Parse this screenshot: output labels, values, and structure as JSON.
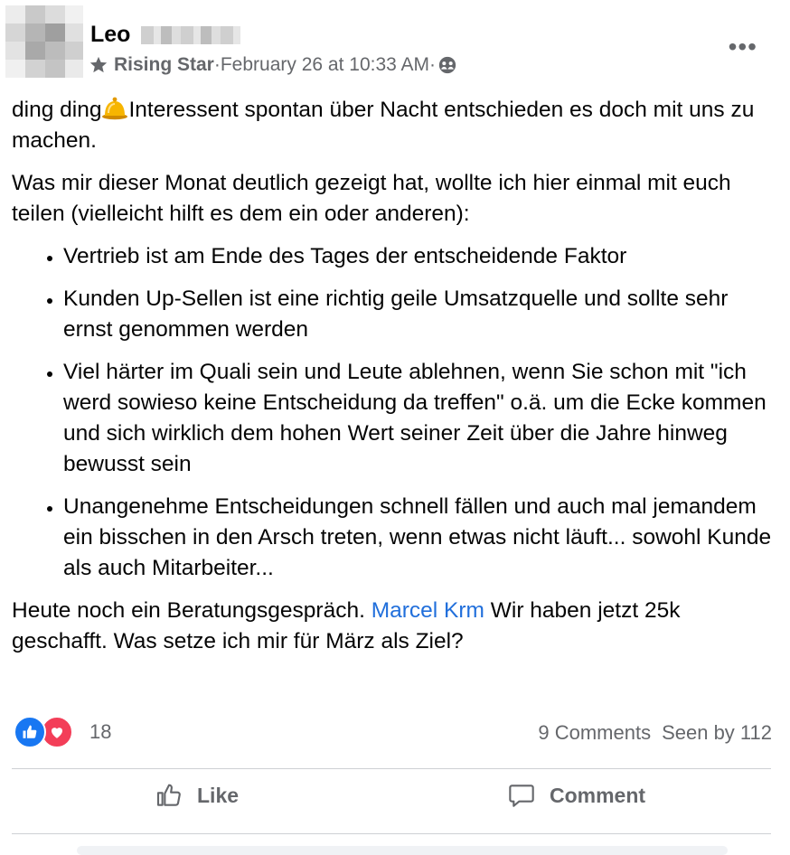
{
  "post": {
    "author_name": "Leo",
    "badge": "Rising Star",
    "separator": " · ",
    "timestamp": "February 26 at 10:33 AM",
    "separator2": " · ",
    "intro_start": "ding ding",
    "intro_rest": "Interessent spontan über Nacht entschieden es doch mit uns zu machen.",
    "paragraph2": "Was mir dieser Monat deutlich gezeigt hat, wollte ich hier einmal mit euch teilen (vielleicht hilft es dem ein oder anderen):",
    "bullets": [
      "Vertrieb ist am Ende des Tages der entscheidende Faktor",
      "Kunden Up-Sellen ist eine richtig geile Umsatzquelle und sollte sehr ernst genommen werden",
      "Viel härter im Quali sein und Leute ablehnen, wenn Sie schon mit \"ich werd sowieso keine Entscheidung da treffen\" o.ä. um die Ecke kommen und sich wirklich dem hohen Wert seiner Zeit über die Jahre hinweg bewusst sein",
      "Unangenehme Entscheidungen schnell fällen und auch mal jemandem ein bisschen in den Arsch treten, wenn etwas nicht läuft... sowohl Kunde als auch Mitarbeiter..."
    ],
    "closing_start": "Heute noch ein Beratungsgespräch. ",
    "mention": "Marcel Krm",
    "closing_end": " Wir haben jetzt 25k geschafft. Was setze ich mir für März als Ziel?",
    "more_label": "•••"
  },
  "reactions": {
    "count": "18",
    "comments": "9 Comments",
    "seen": "Seen by 112",
    "like_color": "#1877f2",
    "love_color": "#f33e58"
  },
  "actions": {
    "like_label": "Like",
    "comment_label": "Comment"
  },
  "icons": {
    "badge": "star-icon",
    "audience": "group-icon",
    "bell": "bell-emoji-icon",
    "more": "more-horizontal-icon",
    "like_action": "thumbs-up-icon",
    "comment_action": "speech-bubble-icon"
  }
}
